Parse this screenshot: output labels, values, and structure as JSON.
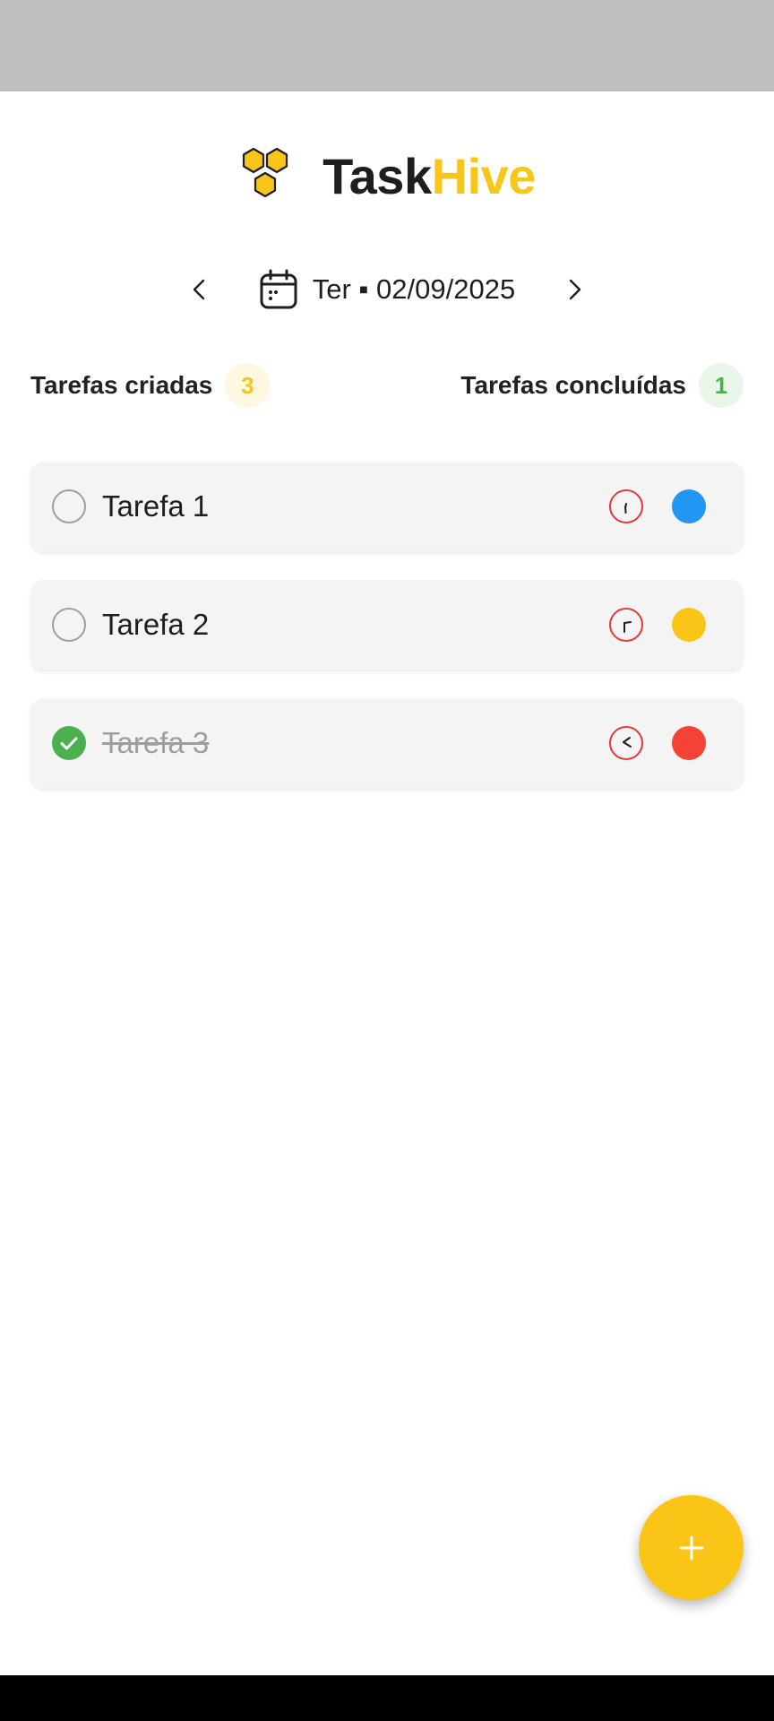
{
  "app": {
    "name_part1": "Task",
    "name_part2": "Hive",
    "brand_color": "#f8c519"
  },
  "date_nav": {
    "date_label": "Ter ▪ 02/09/2025",
    "prev_icon": "chevron-left-icon",
    "next_icon": "chevron-right-icon",
    "calendar_icon": "calendar-icon"
  },
  "counters": {
    "created_label": "Tarefas criadas",
    "created_count": "3",
    "completed_label": "Tarefas concluídas",
    "completed_count": "1"
  },
  "tasks": [
    {
      "title": "Tarefa 1",
      "done": false,
      "priority_color": "#2196f3",
      "clock_icon": "clock-icon"
    },
    {
      "title": "Tarefa 2",
      "done": false,
      "priority_color": "#fbc518",
      "clock_icon": "clock-icon"
    },
    {
      "title": "Tarefa 3",
      "done": true,
      "priority_color": "#f44336",
      "clock_icon": "clock-icon"
    }
  ],
  "fab": {
    "icon": "plus-icon"
  },
  "colors": {
    "done_green": "#4caf50",
    "clock_red": "#e53935"
  }
}
